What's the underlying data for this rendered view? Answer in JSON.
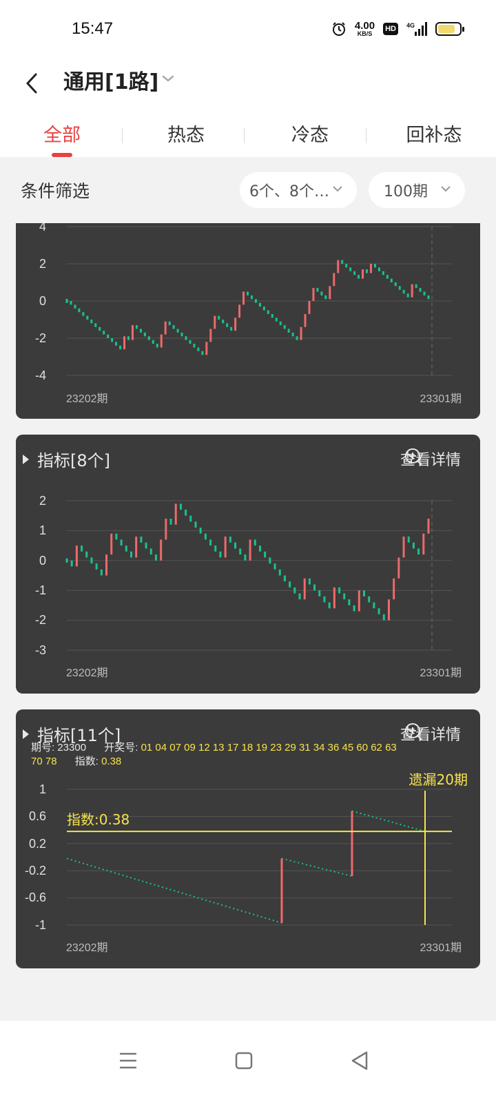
{
  "status_bar": {
    "time": "15:47",
    "net_speed_value": "4.00",
    "net_speed_unit": "KB/S",
    "hd_badge": "HD",
    "network": "4G",
    "battery_level": 0.8,
    "icons": [
      "alarm-icon",
      "hd-icon",
      "signal-icon",
      "battery-icon"
    ]
  },
  "header": {
    "title": "通用[1路]",
    "back_icon": "chevron-left-icon",
    "dropdown_icon": "chevron-down-icon"
  },
  "tabs": [
    {
      "label": "全部",
      "active": true
    },
    {
      "label": "热态",
      "active": false
    },
    {
      "label": "冷态",
      "active": false
    },
    {
      "label": "回补态",
      "active": false
    }
  ],
  "filter": {
    "label": "条件筛选",
    "count_select": "6个、8个…",
    "period_select": "100期"
  },
  "colors": {
    "up": "#ef6a6a",
    "down": "#19c28f",
    "highlight": "#f7e34d",
    "accent": "#e94242"
  },
  "chart_data": [
    {
      "type": "line",
      "title": "",
      "ylim": [
        -4,
        4
      ],
      "yticks": [
        "4",
        "2",
        "0",
        "-2",
        "-4"
      ],
      "x_start": "23202期",
      "x_end": "23301期",
      "values": [
        0,
        -0.2,
        -0.4,
        -0.6,
        -0.8,
        -1.0,
        -1.2,
        -1.4,
        -1.6,
        -1.8,
        -2.0,
        -2.2,
        -2.4,
        -2.6,
        -1.9,
        -2.1,
        -1.3,
        -1.5,
        -1.7,
        -1.9,
        -2.1,
        -2.3,
        -2.5,
        -1.8,
        -1.1,
        -1.3,
        -1.5,
        -1.7,
        -1.9,
        -2.1,
        -2.3,
        -2.5,
        -2.7,
        -2.9,
        -2.2,
        -1.5,
        -0.8,
        -1.0,
        -1.2,
        -1.4,
        -1.6,
        -0.9,
        -0.2,
        0.5,
        0.3,
        0.1,
        -0.1,
        -0.3,
        -0.5,
        -0.7,
        -0.9,
        -1.1,
        -1.3,
        -1.5,
        -1.7,
        -1.9,
        -2.1,
        -1.4,
        -0.7,
        0,
        0.7,
        0.5,
        0.3,
        0.1,
        0.8,
        1.5,
        2.2,
        2.0,
        1.8,
        1.6,
        1.4,
        1.2,
        1.7,
        1.5,
        2.0,
        1.8,
        1.6,
        1.4,
        1.2,
        1.0,
        0.8,
        0.6,
        0.4,
        0.2,
        0.9,
        0.7,
        0.5,
        0.3,
        0.1
      ]
    },
    {
      "type": "line",
      "title": "指标[8个]",
      "detail_label": "查看详情",
      "ylim": [
        -3,
        2
      ],
      "yticks": [
        "2",
        "1",
        "0",
        "-1",
        "-2",
        "-3"
      ],
      "x_start": "23202期",
      "x_end": "23301期",
      "values": [
        0,
        -0.2,
        0.5,
        0.3,
        0.1,
        -0.1,
        -0.3,
        -0.5,
        0.2,
        0.9,
        0.7,
        0.5,
        0.3,
        0.1,
        0.8,
        0.6,
        0.4,
        0.2,
        0,
        0.7,
        1.4,
        1.2,
        1.9,
        1.7,
        1.5,
        1.3,
        1.1,
        0.9,
        0.7,
        0.5,
        0.3,
        0.1,
        0.8,
        0.6,
        0.4,
        0.2,
        0,
        0.7,
        0.5,
        0.3,
        0.1,
        -0.1,
        -0.3,
        -0.5,
        -0.7,
        -0.9,
        -1.1,
        -1.3,
        -0.6,
        -0.8,
        -1.0,
        -1.2,
        -1.4,
        -1.6,
        -0.9,
        -1.1,
        -1.3,
        -1.5,
        -1.7,
        -1.0,
        -1.2,
        -1.4,
        -1.6,
        -1.8,
        -2.0,
        -1.3,
        -0.6,
        0.1,
        0.8,
        0.6,
        0.4,
        0.2,
        0.9,
        1.4
      ]
    },
    {
      "type": "line",
      "title": "指标[11个]",
      "detail_label": "查看详情",
      "info": {
        "period_key": "期号:",
        "period_value": "23300",
        "numbers_key": "开奖号:",
        "numbers_line1": "01 04 07 09 12 13 17 18 19 23 29 31 34 36 45 60 62 63",
        "numbers_line2": "70 78",
        "index_key": "指数:",
        "index_value": "0.38"
      },
      "miss_label": "遗漏20期",
      "index_line_label": "指数:0.38",
      "index_line_value": 0.38,
      "ylim": [
        -1,
        1
      ],
      "yticks": [
        "1",
        "0.6",
        "0.2",
        "-0.2",
        "-0.6",
        "-1"
      ],
      "x_start": "23202期",
      "x_end": "23301期",
      "values": [
        -0.02,
        -0.97,
        -0.02,
        -0.28,
        0.68,
        0.38
      ]
    }
  ],
  "nav": {
    "buttons": [
      "menu-icon",
      "home-icon",
      "back-icon"
    ]
  }
}
